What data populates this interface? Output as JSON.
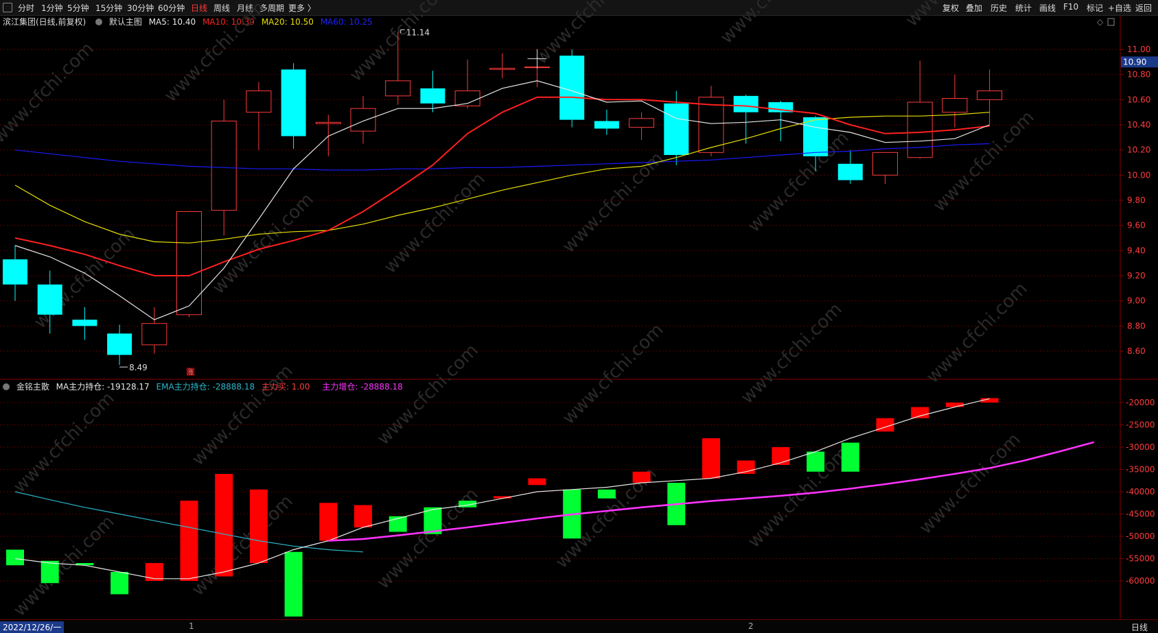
{
  "toolbar": {
    "periods": [
      "分时",
      "1分钟",
      "5分钟",
      "15分钟",
      "30分钟",
      "60分钟",
      "日线",
      "周线",
      "月线",
      "多周期",
      "更多 〉"
    ],
    "active_period": "日线",
    "right_buttons": [
      "复权",
      "叠加",
      "历史",
      "统计",
      "画线",
      "F10",
      "标记",
      "+自选",
      "返回"
    ]
  },
  "main_header": {
    "stock": "滨江集团(日线,前复权)",
    "template": "默认主图",
    "ma5": "MA5: 10.40",
    "ma10": "MA10: 10.39",
    "ma20": "MA20: 10.50",
    "ma60": "MA60: 10.25"
  },
  "colors": {
    "up": "#ff3b3b",
    "down": "#00ffff",
    "ma5": "#e8e8e8",
    "ma10": "#ff2020",
    "ma20": "#e8e000",
    "ma60": "#1a1aff",
    "ema": "#2ab6c9",
    "ma_line": "#e8e8e8",
    "zlzc": "#ff33ff",
    "grid": "#5a0000"
  },
  "price_axis": {
    "ticks": [
      "11.00",
      "10.80",
      "10.60",
      "10.40",
      "10.20",
      "10.00",
      "9.80",
      "9.60",
      "9.40",
      "9.20",
      "9.00",
      "8.80",
      "8.60"
    ],
    "current": "10.90",
    "high_label": "11.14",
    "low_label": "8.49",
    "limit_up_mark": "涨"
  },
  "sub_header": {
    "name": "金铭主散",
    "ma": "MA主力持仓: -19128.17",
    "ema": "EMA主力持仓: -28888.18",
    "buy": "主力买: 1.00",
    "add": "主力增仓: -28888.18"
  },
  "sub_axis": {
    "ticks": [
      "-20000",
      "-25000",
      "-30000",
      "-35000",
      "-40000",
      "-45000",
      "-50000",
      "-55000",
      "-60000"
    ]
  },
  "date_bar": {
    "current_date": "2022/12/26/一",
    "month_labels": [
      "1",
      "2"
    ],
    "period_label": "日线"
  },
  "watermark": "www.cfchi.com",
  "chart_data": {
    "type": "candlestick",
    "candles": [
      {
        "o": 9.33,
        "h": 9.44,
        "l": 9.0,
        "c": 9.13
      },
      {
        "o": 9.13,
        "h": 9.24,
        "l": 8.74,
        "c": 8.89
      },
      {
        "o": 8.85,
        "h": 8.95,
        "l": 8.69,
        "c": 8.8
      },
      {
        "o": 8.74,
        "h": 8.81,
        "l": 8.49,
        "c": 8.57
      },
      {
        "o": 8.65,
        "h": 8.95,
        "l": 8.58,
        "c": 8.82
      },
      {
        "o": 8.89,
        "h": 9.71,
        "l": 8.87,
        "c": 9.71
      },
      {
        "o": 9.72,
        "h": 10.6,
        "l": 9.52,
        "c": 10.43
      },
      {
        "o": 10.5,
        "h": 10.74,
        "l": 10.2,
        "c": 10.67
      },
      {
        "o": 10.84,
        "h": 10.89,
        "l": 10.21,
        "c": 10.31
      },
      {
        "o": 10.41,
        "h": 10.48,
        "l": 10.15,
        "c": 10.42
      },
      {
        "o": 10.35,
        "h": 10.63,
        "l": 10.25,
        "c": 10.53
      },
      {
        "o": 10.63,
        "h": 11.14,
        "l": 10.56,
        "c": 10.75
      },
      {
        "o": 10.69,
        "h": 10.83,
        "l": 10.5,
        "c": 10.57
      },
      {
        "o": 10.55,
        "h": 10.92,
        "l": 10.53,
        "c": 10.67
      },
      {
        "o": 10.84,
        "h": 10.97,
        "l": 10.77,
        "c": 10.85
      },
      {
        "o": 10.86,
        "h": 10.97,
        "l": 10.7,
        "c": 10.86
      },
      {
        "o": 10.95,
        "h": 11.0,
        "l": 10.38,
        "c": 10.44
      },
      {
        "o": 10.43,
        "h": 10.52,
        "l": 10.32,
        "c": 10.37
      },
      {
        "o": 10.38,
        "h": 10.5,
        "l": 10.28,
        "c": 10.45
      },
      {
        "o": 10.57,
        "h": 10.67,
        "l": 10.08,
        "c": 10.16
      },
      {
        "o": 10.18,
        "h": 10.71,
        "l": 10.15,
        "c": 10.62
      },
      {
        "o": 10.63,
        "h": 10.64,
        "l": 10.25,
        "c": 10.5
      },
      {
        "o": 10.58,
        "h": 10.59,
        "l": 10.27,
        "c": 10.5
      },
      {
        "o": 10.46,
        "h": 10.47,
        "l": 10.03,
        "c": 10.15
      },
      {
        "o": 10.09,
        "h": 10.2,
        "l": 9.93,
        "c": 9.96
      },
      {
        "o": 10.0,
        "h": 10.18,
        "l": 9.93,
        "c": 10.18
      },
      {
        "o": 10.14,
        "h": 10.91,
        "l": 10.13,
        "c": 10.58
      },
      {
        "o": 10.5,
        "h": 10.8,
        "l": 10.38,
        "c": 10.61
      },
      {
        "o": 10.6,
        "h": 10.84,
        "l": 10.4,
        "c": 10.67
      }
    ],
    "ma5": [
      9.44,
      9.35,
      9.22,
      9.04,
      8.85,
      8.96,
      9.26,
      9.65,
      10.05,
      10.31,
      10.43,
      10.53,
      10.53,
      10.57,
      10.69,
      10.75,
      10.67,
      10.58,
      10.59,
      10.45,
      10.41,
      10.42,
      10.44,
      10.38,
      10.34,
      10.26,
      10.27,
      10.29,
      10.4
    ],
    "ma10": [
      9.5,
      9.44,
      9.37,
      9.28,
      9.2,
      9.2,
      9.31,
      9.41,
      9.48,
      9.56,
      9.71,
      9.89,
      10.08,
      10.33,
      10.5,
      10.62,
      10.62,
      10.6,
      10.6,
      10.58,
      10.56,
      10.55,
      10.52,
      10.49,
      10.4,
      10.33,
      10.34,
      10.36,
      10.39
    ],
    "ma20": [
      9.92,
      9.76,
      9.63,
      9.53,
      9.47,
      9.46,
      9.49,
      9.53,
      9.55,
      9.56,
      9.61,
      9.68,
      9.74,
      9.81,
      9.88,
      9.94,
      10.0,
      10.05,
      10.07,
      10.14,
      10.22,
      10.29,
      10.37,
      10.44,
      10.46,
      10.47,
      10.47,
      10.48,
      10.5
    ],
    "ma60": [
      10.2,
      10.17,
      10.14,
      10.11,
      10.09,
      10.07,
      10.06,
      10.05,
      10.05,
      10.04,
      10.04,
      10.05,
      10.05,
      10.06,
      10.06,
      10.07,
      10.08,
      10.09,
      10.1,
      10.11,
      10.12,
      10.14,
      10.16,
      10.18,
      10.19,
      10.21,
      10.22,
      10.24,
      10.25
    ],
    "sub_bars": [
      {
        "a": -53000,
        "b": -56500
      },
      {
        "a": -55500,
        "b": -60500
      },
      {
        "a": -56000,
        "b": -56500
      },
      {
        "a": -58000,
        "b": -63000
      },
      {
        "a": -56000,
        "b": -60000
      },
      {
        "a": -42000,
        "b": -60000
      },
      {
        "a": -36000,
        "b": -59000
      },
      {
        "a": -39500,
        "b": -56000
      },
      {
        "a": -53500,
        "b": -68000
      },
      {
        "a": -42500,
        "b": -51000
      },
      {
        "a": -43000,
        "b": -48000
      },
      {
        "a": -45500,
        "b": -49000
      },
      {
        "a": -43500,
        "b": -49500
      },
      {
        "a": -42000,
        "b": -43500
      },
      {
        "a": -41000,
        "b": -41500
      },
      {
        "a": -37000,
        "b": -38500
      },
      {
        "a": -39500,
        "b": -50500
      },
      {
        "a": -39500,
        "b": -41500
      },
      {
        "a": -35500,
        "b": -38000
      },
      {
        "a": -38000,
        "b": -47500
      },
      {
        "a": -28000,
        "b": -37000
      },
      {
        "a": -33000,
        "b": -36000
      },
      {
        "a": -30000,
        "b": -34000
      },
      {
        "a": -31000,
        "b": -35500
      },
      {
        "a": -29000,
        "b": -35500
      },
      {
        "a": -23500,
        "b": -26500
      },
      {
        "a": -21000,
        "b": -23500
      },
      {
        "a": -20000,
        "b": -21000
      },
      {
        "a": -19000,
        "b": -20000
      }
    ],
    "sub_colors": [
      "g",
      "g",
      "g",
      "g",
      "r",
      "r",
      "r",
      "r",
      "g",
      "r",
      "r",
      "g",
      "g",
      "g",
      "r",
      "r",
      "g",
      "g",
      "r",
      "g",
      "r",
      "r",
      "r",
      "g",
      "g",
      "r",
      "r",
      "r",
      "r"
    ],
    "ma_hold": [
      -55000,
      -56000,
      -56500,
      -58000,
      -59500,
      -59500,
      -58000,
      -56000,
      -53000,
      -51000,
      -48000,
      -46000,
      -44000,
      -43000,
      -41500,
      -40000,
      -39500,
      -39000,
      -38000,
      -37500,
      -37000,
      -35500,
      -33500,
      -31000,
      -28000,
      -25500,
      -23000,
      -21000,
      -19128
    ],
    "ema_hold": [
      -40000,
      -41800,
      -43500,
      -45000,
      -46500,
      -48000,
      -49500,
      -51000,
      -52200,
      -53000,
      -53500
    ],
    "zl_add": [
      -51000,
      -50600,
      -49800,
      -48900,
      -48000,
      -47000,
      -46000,
      -45100,
      -44300,
      -43500,
      -42800,
      -42100,
      -41500,
      -40900,
      -40200,
      -39300,
      -38300,
      -37200,
      -36000,
      -34700,
      -33000,
      -31000,
      -28888
    ],
    "zl_add_start": 9
  }
}
